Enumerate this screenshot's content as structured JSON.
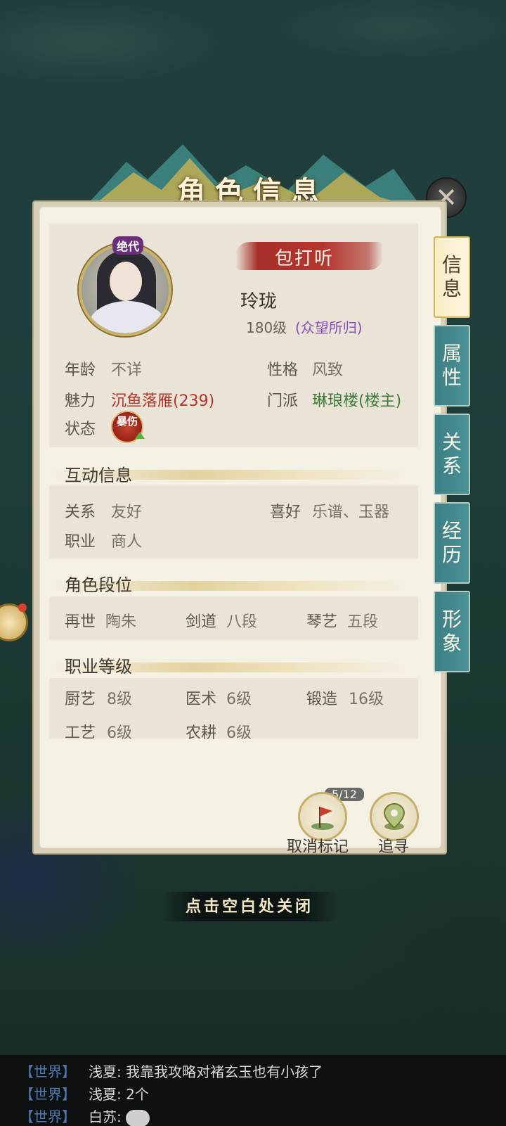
{
  "title": "角色信息",
  "character": {
    "rank_badge": "绝代",
    "inquire_button": "包打听",
    "name": "玲珑",
    "level": "180级",
    "reputation": "(众望所归)",
    "info": {
      "age_label": "年龄",
      "age_value": "不详",
      "personality_label": "性格",
      "personality_value": "风致",
      "charm_label": "魅力",
      "charm_value": "沉鱼落雁(239)",
      "sect_label": "门派",
      "sect_value": "琳琅楼(楼主)",
      "status_label": "状态",
      "status_icon": "暴伤"
    }
  },
  "interaction": {
    "section_title": "互动信息",
    "relation_label": "关系",
    "relation_value": "友好",
    "hobby_label": "喜好",
    "hobby_value": "乐谱、玉器",
    "job_label": "职业",
    "job_value": "商人"
  },
  "ranks": {
    "section_title": "角色段位",
    "items": [
      {
        "label": "再世",
        "value": "陶朱"
      },
      {
        "label": "剑道",
        "value": "八段"
      },
      {
        "label": "琴艺",
        "value": "五段"
      }
    ]
  },
  "job_levels": {
    "section_title": "职业等级",
    "items": [
      {
        "label": "厨艺",
        "value": "8级"
      },
      {
        "label": "医术",
        "value": "6级"
      },
      {
        "label": "锻造",
        "value": "16级"
      },
      {
        "label": "工艺",
        "value": "6级"
      },
      {
        "label": "农耕",
        "value": "6级"
      }
    ]
  },
  "tabs": [
    {
      "label_top": "信",
      "label_bottom": "息",
      "active": true
    },
    {
      "label_top": "属",
      "label_bottom": "性",
      "active": false
    },
    {
      "label_top": "关",
      "label_bottom": "系",
      "active": false
    },
    {
      "label_top": "经",
      "label_bottom": "历",
      "active": false
    },
    {
      "label_top": "形",
      "label_bottom": "象",
      "active": false
    }
  ],
  "actions": {
    "mark_counter": "5/12",
    "cancel_mark": "取消标记",
    "track": "追寻"
  },
  "close_hint": "点击空白处关闭",
  "chat": [
    {
      "channel": "【世界】",
      "message": "浅夏: 我靠我攻略对褚玄玉也有小孩了"
    },
    {
      "channel": "【世界】",
      "message": "浅夏: 2个"
    },
    {
      "channel": "【世界】",
      "message": "白苏:"
    }
  ],
  "colors": {
    "tab_teal": "#3b7f84",
    "tab_active": "#f6ecc6",
    "accent_red": "#b2352b",
    "accent_green": "#3f7a38",
    "accent_purple": "#8b4fb4",
    "chat_channel": "#4d7bb3"
  },
  "icons": {
    "close": "close-icon",
    "flag": "flag-icon",
    "location": "location-pin-icon",
    "chat_bubble": "chat-bubble-icon"
  }
}
